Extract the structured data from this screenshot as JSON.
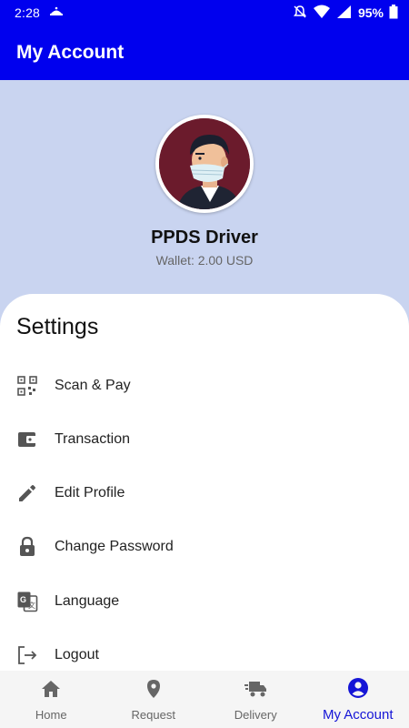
{
  "status_bar": {
    "time": "2:28",
    "battery": "95%"
  },
  "app_bar": {
    "title": "My Account"
  },
  "profile": {
    "name": "PPDS Driver",
    "wallet": "Wallet: 2.00 USD"
  },
  "settings": {
    "title": "Settings",
    "items": [
      {
        "label": "Scan & Pay",
        "icon": "qr-code-icon"
      },
      {
        "label": "Transaction",
        "icon": "wallet-icon"
      },
      {
        "label": "Edit Profile",
        "icon": "pencil-icon"
      },
      {
        "label": "Change Password",
        "icon": "lock-icon"
      },
      {
        "label": "Language",
        "icon": "translate-icon"
      },
      {
        "label": "Logout",
        "icon": "logout-icon"
      }
    ]
  },
  "bottom_nav": {
    "items": [
      {
        "label": "Home",
        "icon": "home-icon"
      },
      {
        "label": "Request",
        "icon": "location-pin-icon"
      },
      {
        "label": "Delivery",
        "icon": "truck-icon"
      },
      {
        "label": "My Account",
        "icon": "account-circle-icon",
        "active": true
      }
    ]
  },
  "colors": {
    "primary": "#0000ee",
    "profile_bg": "#c9d4f0",
    "active_nav": "#1515d6",
    "avatar_bg": "#6b1b2c"
  }
}
